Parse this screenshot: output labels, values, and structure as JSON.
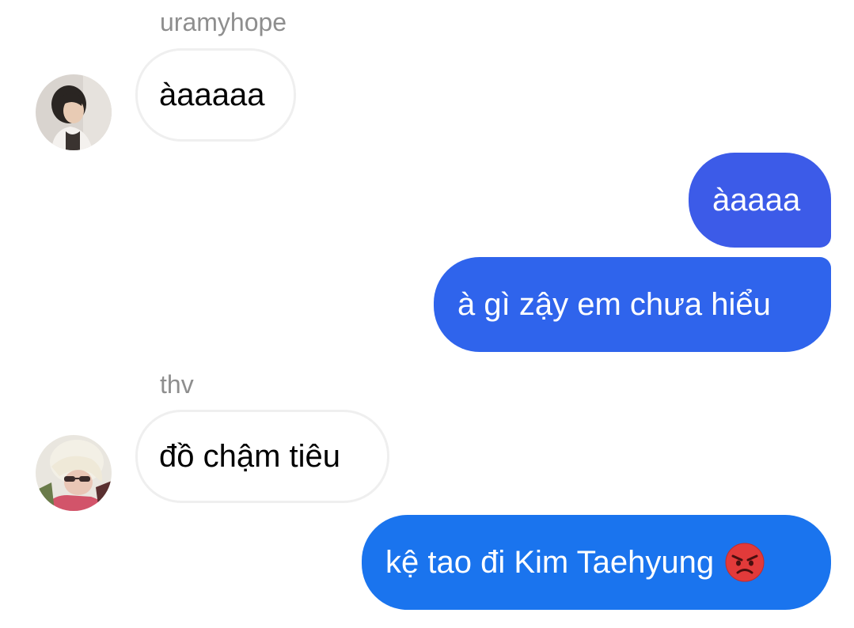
{
  "chat": {
    "messages": [
      {
        "sender": "uramyhope",
        "text": "àaaaaa",
        "direction": "incoming",
        "avatar_icon": "avatar-uramyhope"
      },
      {
        "text": "àaaaa",
        "direction": "outgoing"
      },
      {
        "text": "à gì zậy em chưa hiểu",
        "direction": "outgoing"
      },
      {
        "sender": "thv",
        "text": "đồ chậm tiêu",
        "direction": "incoming",
        "avatar_icon": "avatar-thv"
      },
      {
        "text": "kệ tao đi Kim Taehyung",
        "direction": "outgoing",
        "emoji": "angry-face-icon"
      }
    ]
  },
  "colors": {
    "outgoing_gradient_top": "#4458e8",
    "outgoing_gradient_bottom": "#1877f2",
    "incoming_border": "#efefef",
    "sender_name": "#8e8e8e"
  }
}
